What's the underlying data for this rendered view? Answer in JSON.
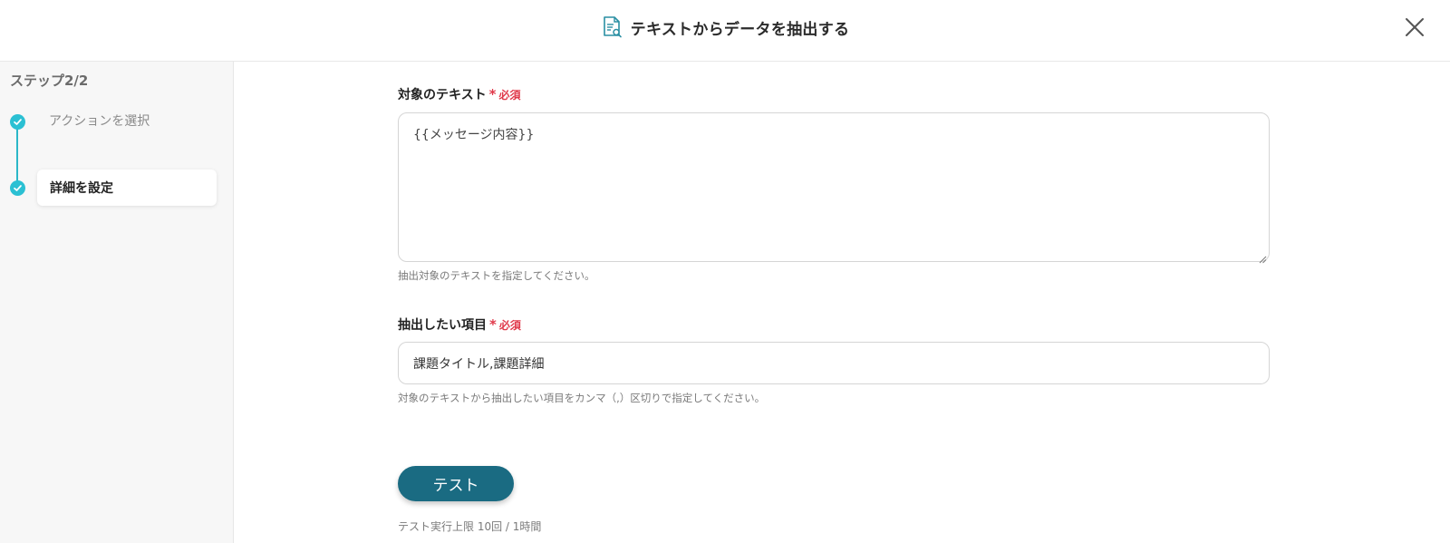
{
  "header": {
    "title": "テキストからデータを抽出する",
    "title_icon": "document-search-icon",
    "close_icon": "close-icon"
  },
  "sidebar": {
    "step_label": "ステップ2/2",
    "steps": [
      {
        "label": "アクションを選択",
        "status": "done",
        "active": false
      },
      {
        "label": "詳細を設定",
        "status": "done",
        "active": true
      }
    ]
  },
  "form": {
    "target_text": {
      "label": "対象のテキスト",
      "required_mark": "*",
      "required_text": "必須",
      "value": "{{メッセージ内容}}",
      "help": "抽出対象のテキストを指定してください。"
    },
    "extract_items": {
      "label": "抽出したい項目",
      "required_mark": "*",
      "required_text": "必須",
      "value": "課題タイトル,課題詳細",
      "help": "対象のテキストから抽出したい項目をカンマ（,）区切りで指定してください。"
    },
    "test_button_label": "テスト",
    "test_limit": "テスト実行上限 10回 / 1時間"
  },
  "colors": {
    "accent_teal": "#2bc0d3",
    "button": "#1a6b82",
    "required": "#e0394a"
  }
}
